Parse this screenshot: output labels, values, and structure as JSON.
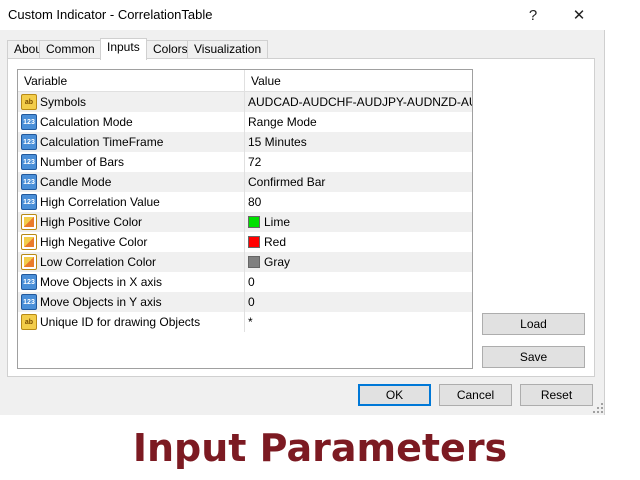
{
  "window": {
    "title": "Custom Indicator - CorrelationTable",
    "help_glyph": "?",
    "close_glyph": "✕"
  },
  "tabs": [
    {
      "label": "About",
      "active": false
    },
    {
      "label": "Common",
      "active": false
    },
    {
      "label": "Inputs",
      "active": true
    },
    {
      "label": "Colors",
      "active": false
    },
    {
      "label": "Visualization",
      "active": false
    }
  ],
  "grid": {
    "headers": {
      "variable": "Variable",
      "value": "Value"
    },
    "rows": [
      {
        "icon": "ab",
        "type": "string",
        "variable": "Symbols",
        "value": "AUDCAD-AUDCHF-AUDJPY-AUDNZD-AU..."
      },
      {
        "icon": "123",
        "type": "number",
        "variable": "Calculation Mode",
        "value": "Range Mode"
      },
      {
        "icon": "123",
        "type": "number",
        "variable": "Calculation TimeFrame",
        "value": "15 Minutes"
      },
      {
        "icon": "123",
        "type": "number",
        "variable": "Number of Bars",
        "value": "72"
      },
      {
        "icon": "123",
        "type": "number",
        "variable": "Candle Mode",
        "value": "Confirmed Bar"
      },
      {
        "icon": "123",
        "type": "number",
        "variable": "High Correlation Value",
        "value": "80"
      },
      {
        "icon": "",
        "type": "color",
        "variable": "High Positive Color",
        "value": "Lime",
        "swatch": "#00e000"
      },
      {
        "icon": "",
        "type": "color",
        "variable": "High Negative Color",
        "value": "Red",
        "swatch": "#ff0000"
      },
      {
        "icon": "",
        "type": "color",
        "variable": "Low Correlation Color",
        "value": "Gray",
        "swatch": "#808080"
      },
      {
        "icon": "123",
        "type": "number",
        "variable": "Move Objects in X axis",
        "value": "0"
      },
      {
        "icon": "123",
        "type": "number",
        "variable": "Move Objects in Y axis",
        "value": "0"
      },
      {
        "icon": "ab",
        "type": "string",
        "variable": "Unique ID for drawing Objects",
        "value": "*"
      }
    ]
  },
  "side_buttons": {
    "load": "Load",
    "save": "Save"
  },
  "footer_buttons": {
    "ok": "OK",
    "cancel": "Cancel",
    "reset": "Reset"
  },
  "caption": "Input Parameters",
  "colors": {
    "caption": "#7c1a22",
    "primary_border": "#0078d7",
    "alt_row": "#f0f0f0"
  }
}
